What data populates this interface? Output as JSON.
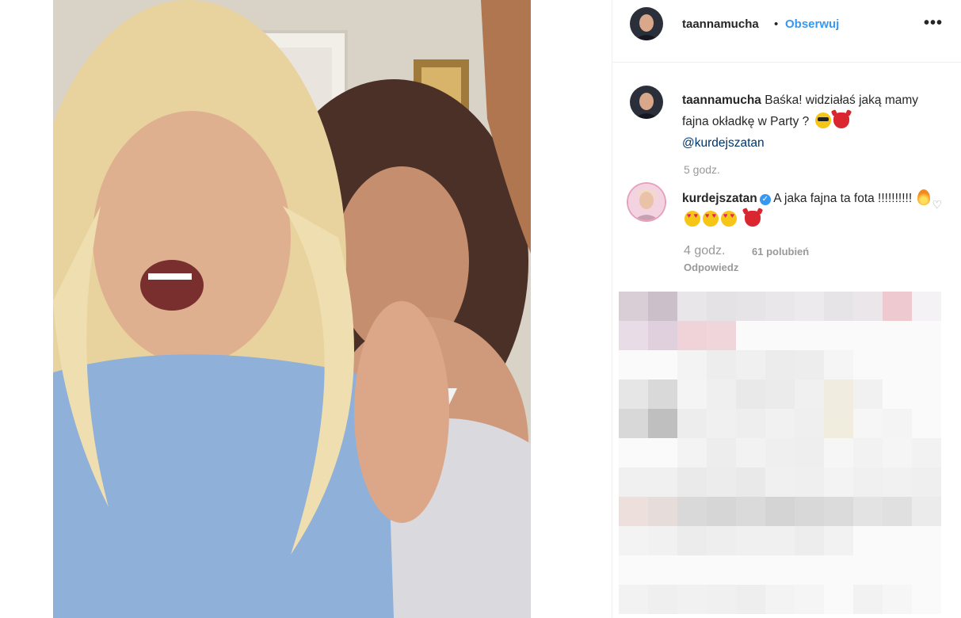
{
  "post": {
    "author": "taannamucha",
    "separator": "•",
    "follow_label": "Obserwuj",
    "more_label": "•••"
  },
  "caption": {
    "username": "taannamucha",
    "text": " Baśka! widziałaś jaką mamy fajna okładkę w Party ? ",
    "emojis": [
      "smiling-face-with-sunglasses",
      "smiling-face-with-horns"
    ],
    "mention": "@kurdejszatan",
    "time": "5 godz."
  },
  "comment": {
    "username": "kurdejszatan",
    "verified": true,
    "text": " A jaka fajna ta fota !!!!!!!!!! ",
    "emojis": [
      "fire",
      "heart-eyes",
      "heart-eyes",
      "heart-eyes",
      "smiling-face-with-horns"
    ],
    "time": "4 godz.",
    "likes": "61 polubień",
    "reply_label": "Odpowiedz",
    "like_icon": "heart-outline-icon"
  },
  "colors": {
    "link": "#3897f0",
    "text": "#262626",
    "muted": "#999999",
    "divider": "#efefef"
  }
}
